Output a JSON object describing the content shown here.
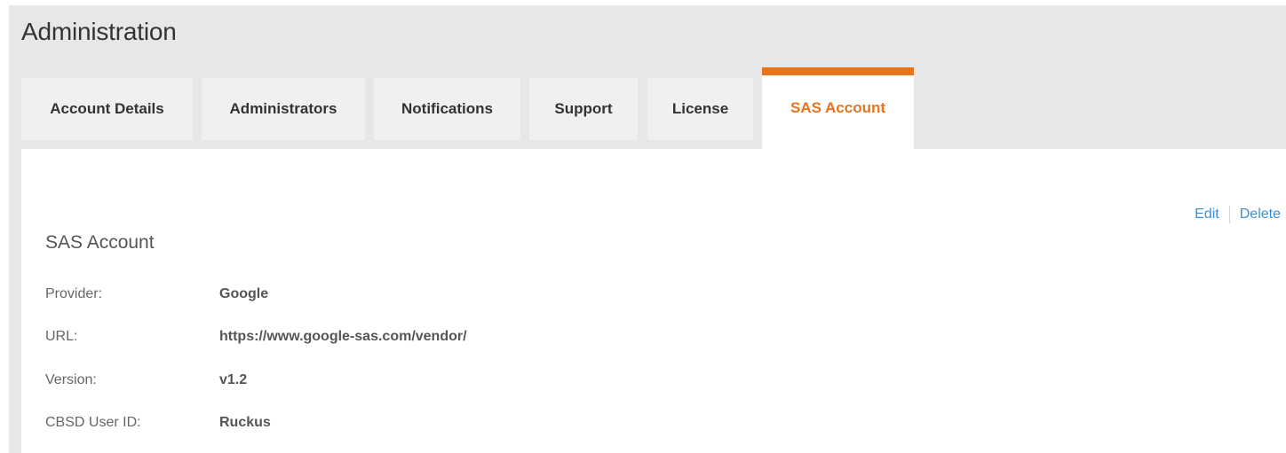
{
  "header": {
    "title": "Administration"
  },
  "tabs": [
    {
      "label": "Account Details",
      "active": false
    },
    {
      "label": "Administrators",
      "active": false
    },
    {
      "label": "Notifications",
      "active": false
    },
    {
      "label": "Support",
      "active": false
    },
    {
      "label": "License",
      "active": false
    },
    {
      "label": "SAS Account",
      "active": true
    }
  ],
  "actions": {
    "edit_label": "Edit",
    "delete_label": "Delete"
  },
  "section": {
    "title": "SAS Account",
    "fields": [
      {
        "label": "Provider:",
        "value": "Google"
      },
      {
        "label": "URL:",
        "value": "https://www.google-sas.com/vendor/"
      },
      {
        "label": "Version:",
        "value": "v1.2"
      },
      {
        "label": "CBSD User ID:",
        "value": "Ruckus"
      }
    ]
  },
  "colors": {
    "accent": "#e8731d",
    "link": "#3a8fd6",
    "background": "#e6e7e8",
    "tab_inactive": "#eef0f1"
  }
}
